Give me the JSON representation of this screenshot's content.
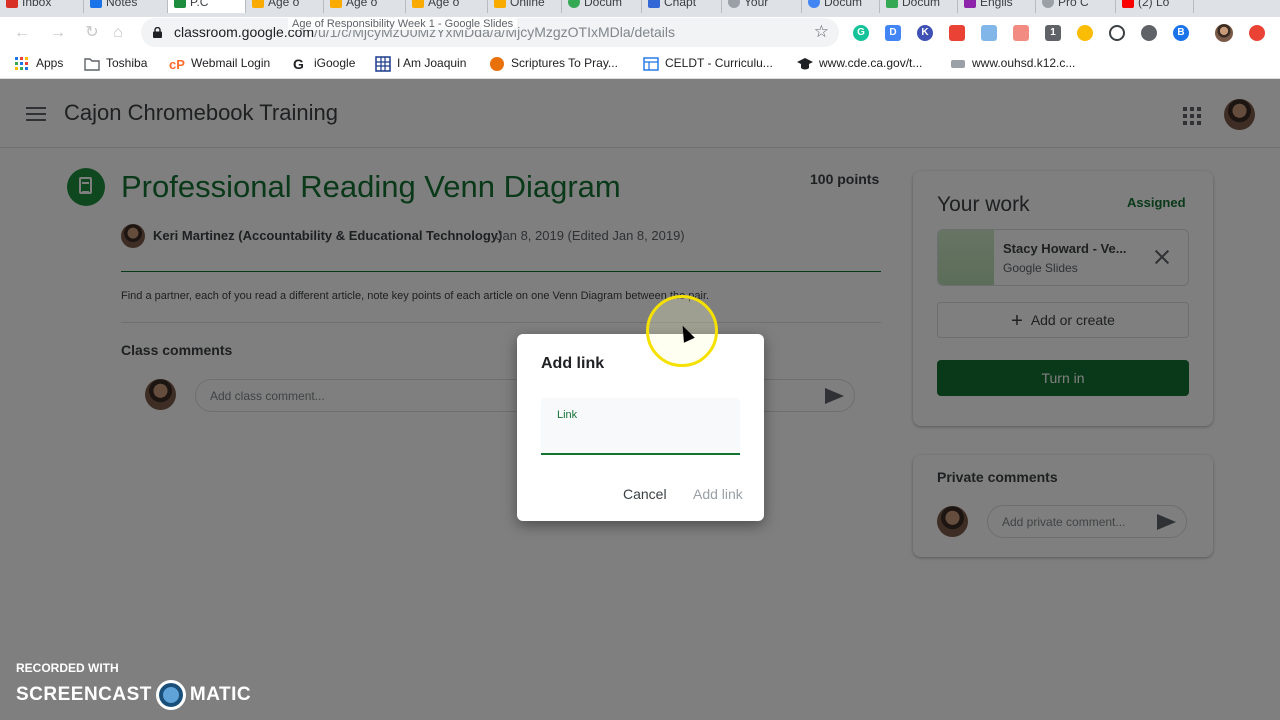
{
  "browser": {
    "tabs": [
      "Inbox",
      "Notes",
      "P.C",
      "Age o",
      "Age o",
      "Age o",
      "Online",
      "Docum",
      "Chapt",
      "Your",
      "Docum",
      "Docum",
      "Englis",
      "Pro C",
      "(2) Lo"
    ],
    "tooltip": "Age of Responsibility Week 1 - Google Slides",
    "url_host": "classroom.google.com",
    "url_path": "/u/1/c/MjcyMzU0MzYxMDda/a/MjcyMzgzOTIxMDla/details"
  },
  "bookmarks": [
    {
      "label": "Apps",
      "icon": "apps-grid-icon"
    },
    {
      "label": "Toshiba",
      "icon": "folder-icon"
    },
    {
      "label": "Webmail Login",
      "icon": "cpanel-icon"
    },
    {
      "label": "iGoogle",
      "icon": "google-icon"
    },
    {
      "label": "I Am Joaquin",
      "icon": "grid-site-icon"
    },
    {
      "label": "Scriptures To Pray...",
      "icon": "site-icon"
    },
    {
      "label": "CELDT - Curriculu...",
      "icon": "page-icon"
    },
    {
      "label": "www.cde.ca.gov/t...",
      "icon": "graduation-cap-icon"
    },
    {
      "label": "www.ouhsd.k12.c...",
      "icon": "site-icon"
    }
  ],
  "classroom": {
    "class_name": "Cajon Chromebook Training"
  },
  "assignment": {
    "title": "Professional Reading Venn Diagram",
    "points": "100 points",
    "author": "Keri Martinez (Accountability & Educational Technology)",
    "date": "Jan 8, 2019 (Edited Jan 8, 2019)",
    "description": "Find a partner, each of you read a different article, note key points of each article on one Venn Diagram between the pair.",
    "class_comments_label": "Class comments",
    "class_comment_placeholder": "Add class comment..."
  },
  "your_work": {
    "title": "Your work",
    "status": "Assigned",
    "attachment_name": "Stacy Howard - Ve...",
    "attachment_type": "Google Slides",
    "add_or_create": "Add or create",
    "turn_in": "Turn in"
  },
  "private_comments": {
    "title": "Private comments",
    "placeholder": "Add private comment..."
  },
  "dialog": {
    "title": "Add link",
    "field_label": "Link",
    "cancel": "Cancel",
    "add_link": "Add link"
  },
  "watermark": {
    "line1": "RECORDED WITH",
    "left": "SCREENCAST",
    "right": "MATIC"
  },
  "colors": {
    "accent_green": "#137333",
    "icon_green": "#1e8e3e",
    "overlay": "rgba(0,0,0,0.5)"
  }
}
